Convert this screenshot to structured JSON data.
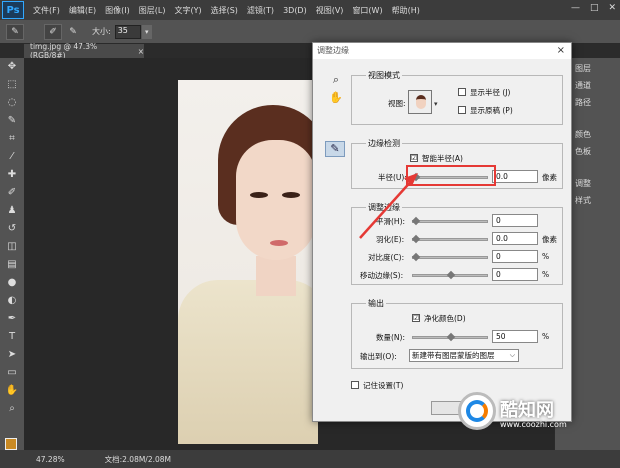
{
  "app": {
    "logo": "Ps"
  },
  "menubar": {
    "items": [
      "文件(F)",
      "编辑(E)",
      "图像(I)",
      "图层(L)",
      "文字(Y)",
      "选择(S)",
      "滤镜(T)",
      "3D(D)",
      "视图(V)",
      "窗口(W)",
      "帮助(H)"
    ],
    "window_controls": [
      "—",
      "□",
      "✕"
    ]
  },
  "options_bar": {
    "size_label": "大小:",
    "size_value": "35"
  },
  "document_tab": {
    "title": "timg.jpg @ 47.3%(RGB/8#)",
    "close": "×"
  },
  "status_bar": {
    "zoom": "47.28%",
    "doc_info": "文档:2.08M/2.08M"
  },
  "right_panels": {
    "items": [
      {
        "label": "图层",
        "icon": "layers-icon"
      },
      {
        "label": "通道",
        "icon": "channels-icon"
      },
      {
        "label": "路径",
        "icon": "paths-icon"
      },
      {
        "label": "颜色",
        "icon": "color-icon"
      },
      {
        "label": "色板",
        "icon": "swatches-icon"
      },
      {
        "label": "调整",
        "icon": "adjust-icon"
      },
      {
        "label": "样式",
        "icon": "styles-icon"
      }
    ]
  },
  "dialog": {
    "title": "调整边缘",
    "close": "×",
    "view_mode": {
      "title": "视图模式",
      "view_label": "视图:",
      "show_radius_label": "显示半径 (J)",
      "show_original_label": "显示原稿 (P)"
    },
    "edge_detection": {
      "title": "边缘检测",
      "smart_radius_check": "☑",
      "smart_radius_label": "智能半径(A)",
      "radius_label": "半径(U):",
      "radius_value": "0.0",
      "radius_unit": "像素",
      "radius_fraction": 0.0
    },
    "adjust_edge": {
      "title": "调整边缘",
      "smooth_label": "平滑(H):",
      "smooth_value": "0",
      "feather_label": "羽化(E):",
      "feather_value": "0.0",
      "feather_unit": "像素",
      "contrast_label": "对比度(C):",
      "contrast_value": "0",
      "contrast_unit": "%",
      "shift_label": "移动边缘(S):",
      "shift_value": "0",
      "shift_unit": "%"
    },
    "output": {
      "title": "输出",
      "decontaminate_check": "☑",
      "decontaminate_label": "净化颜色(D)",
      "amount_label": "数量(N):",
      "amount_value": "50",
      "amount_unit": "%",
      "output_to_label": "输出到(O):",
      "output_to_value": "新建带有图层蒙版的图层"
    },
    "remember_label": "记住设置(T)"
  },
  "watermark": {
    "title": "酷知网",
    "url": "www.coozhi.com"
  },
  "colors": {
    "highlight": "#e53935",
    "fg_swatch": "#c98a24"
  }
}
